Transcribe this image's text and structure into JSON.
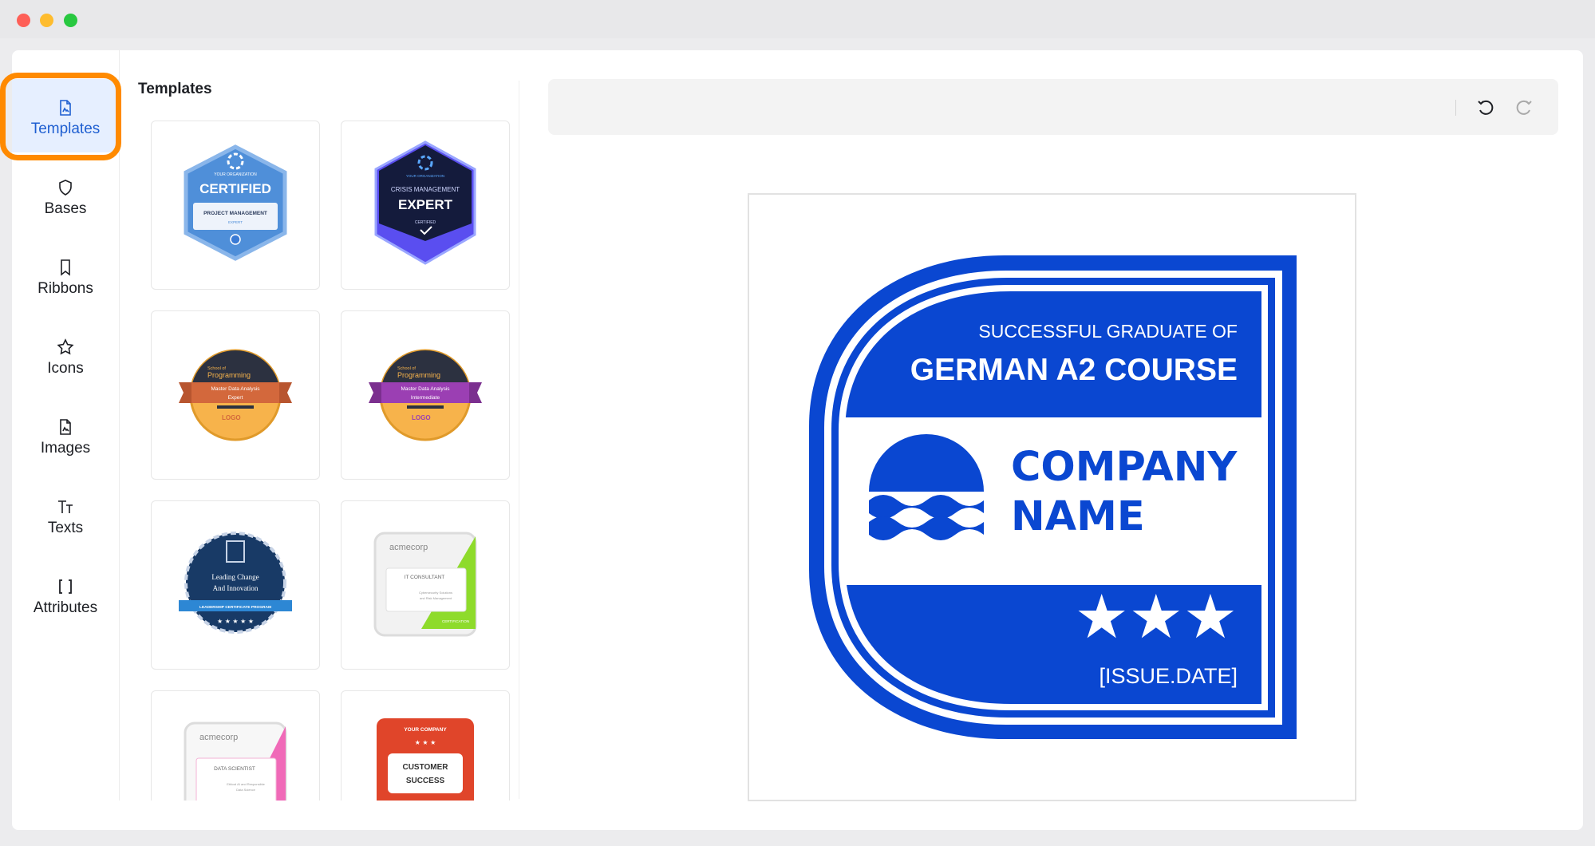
{
  "window": {
    "controls": [
      "close",
      "minimize",
      "zoom"
    ]
  },
  "nav": {
    "items": [
      {
        "label": "Templates",
        "icon": "template-file-icon",
        "active": true
      },
      {
        "label": "Bases",
        "icon": "shield-icon",
        "active": false
      },
      {
        "label": "Ribbons",
        "icon": "bookmark-icon",
        "active": false
      },
      {
        "label": "Icons",
        "icon": "star-icon",
        "active": false
      },
      {
        "label": "Images",
        "icon": "image-file-icon",
        "active": false
      },
      {
        "label": "Texts",
        "icon": "text-size-icon",
        "active": false
      },
      {
        "label": "Attributes",
        "icon": "brackets-icon",
        "active": false
      }
    ]
  },
  "templates": {
    "title": "Templates",
    "cards": [
      {
        "name": "certified-pm",
        "lines": [
          "YOUR ORGANIZATION",
          "CERTIFIED",
          "PROJECT MANAGEMENT",
          "EXPERT"
        ]
      },
      {
        "name": "crisis-expert",
        "lines": [
          "YOUR ORGANIZATION",
          "CRISIS MANAGEMENT",
          "EXPERT",
          "CERTIFIED"
        ]
      },
      {
        "name": "programming-expert",
        "lines": [
          "School of",
          "Programming",
          "Master Data Analysis",
          "Expert",
          "LOGO"
        ]
      },
      {
        "name": "programming-intermediate",
        "lines": [
          "School of",
          "Programming",
          "Master Data Analysis",
          "Intermediate",
          "LOGO"
        ]
      },
      {
        "name": "leadership",
        "lines": [
          "Leading Change",
          "And Innovation",
          "LEADERSHIP CERTIFICATE PROGRAM"
        ]
      },
      {
        "name": "it-consultant",
        "lines": [
          "acmecorp",
          "IT CONSULTANT",
          "Cybersecurity Solutions",
          "and Risk Management",
          "CERTIFICATION"
        ]
      },
      {
        "name": "data-scientist",
        "lines": [
          "acmecorp",
          "DATA SCIENTIST",
          "Ethical AI and Responsible",
          "Data Science"
        ]
      },
      {
        "name": "customer-success",
        "lines": [
          "YOUR COMPANY",
          "★ ★ ★",
          "CUSTOMER",
          "SUCCESS"
        ]
      }
    ]
  },
  "toolbar": {
    "undo": "undo-icon",
    "redo": "redo-icon"
  },
  "badge": {
    "subtitle": "SUCCESSFUL GRADUATE OF",
    "title": "GERMAN A2 COURSE",
    "company_line1": "COMPANY",
    "company_line2": "NAME",
    "stars": "★★★",
    "date": "[ISSUE.DATE]",
    "colors": {
      "primary": "#0a47d1",
      "background": "#ffffff"
    }
  },
  "colors": {
    "accent": "#1f5fd1",
    "highlight": "#ff8a00"
  }
}
